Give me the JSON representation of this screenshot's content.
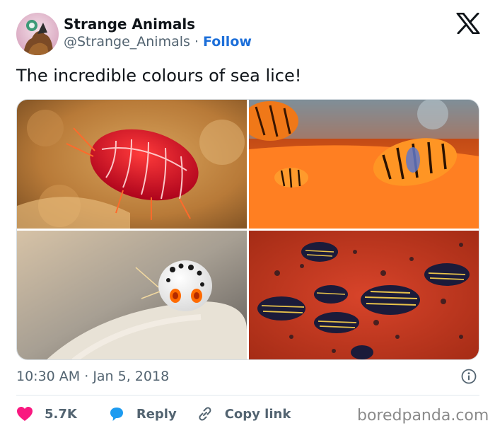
{
  "header": {
    "display_name": "Strange Animals",
    "handle": "@Strange_Animals",
    "separator": " · ",
    "follow_label": "Follow",
    "platform_icon": "x-logo-icon"
  },
  "tweet": {
    "text": "The incredible colours of sea lice!"
  },
  "photos": [
    {
      "subject": "red sea louse on sponge"
    },
    {
      "subject": "orange striped sea lice on orange surface"
    },
    {
      "subject": "white spotted sea louse"
    },
    {
      "subject": "blue striped sea lice on red surface"
    }
  ],
  "meta": {
    "time": "10:30 AM",
    "separator": " · ",
    "date": "Jan 5, 2018"
  },
  "actions": {
    "likes_count": "5.7K",
    "reply_label": "Reply",
    "copy_label": "Copy link"
  },
  "watermark": "boredpanda.com",
  "colors": {
    "like_heart": "#f91880",
    "reply_bubble": "#1d9bf0",
    "follow_link": "#1d6fd9"
  }
}
